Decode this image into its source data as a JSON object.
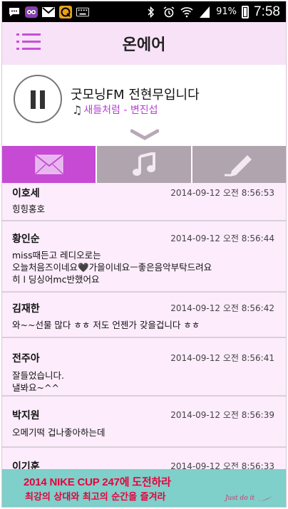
{
  "status_bar": {
    "battery": "91%",
    "time": "7:58",
    "icons": [
      "sms-icon",
      "owl-app-icon",
      "gmail-icon",
      "radio-app-icon",
      "keyboard-icon",
      "bluetooth-icon",
      "alarm-icon",
      "wifi-icon",
      "signal-icon",
      "battery-icon"
    ]
  },
  "header": {
    "title": "온에어"
  },
  "player": {
    "program_title": "굿모닝FM 전현무입니다",
    "song": "새들처럼 - 변진섭"
  },
  "tabs": [
    {
      "name": "messages",
      "icon": "envelope-icon",
      "active": true
    },
    {
      "name": "music",
      "icon": "music-note-icon",
      "active": false
    },
    {
      "name": "write",
      "icon": "pencil-icon",
      "active": false
    }
  ],
  "messages": [
    {
      "name": "이호세",
      "time": "2014-09-12 오전 8:56:53",
      "body": [
        "힝힝홍호"
      ]
    },
    {
      "name": "황인순",
      "time": "2014-09-12 오전 8:56:44",
      "body": [
        "miss때든고 레디오로는",
        "오늘처음즈이네요🖤가을이네요ㅡ좋은음악부탁드려요",
        "히 l 딩싱어mc반했어요"
      ]
    },
    {
      "name": "김재한",
      "time": "2014-09-12 오전 8:56:42",
      "body": [
        "와~~선물 많다 ㅎㅎ 저도 언젠가 갖을겁니다 ㅎㅎ"
      ]
    },
    {
      "name": "전주아",
      "time": "2014-09-12 오전 8:56:41",
      "body": [
        "잘들었습니다.",
        "낼봐요~^^"
      ]
    },
    {
      "name": "박지원",
      "time": "2014-09-12 오전 8:56:39",
      "body": [
        "오메기떡 겁나좋아하는데"
      ]
    },
    {
      "name": "이기훈",
      "time": "2014-09-12 오전 8:56:33",
      "body": []
    }
  ],
  "banner": {
    "line1": "2014 NIKE CUP 247에 도전하라",
    "line2": "최강의 상대와 최고의 순간을 즐겨라",
    "tagline": "Just do it",
    "color": "#7fcfca",
    "text_color": "#e9003b"
  },
  "accent_color": "#c64ad4"
}
